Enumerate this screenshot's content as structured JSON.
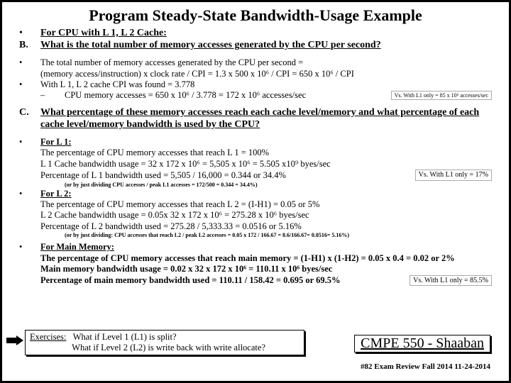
{
  "title": "Program Steady-State Bandwidth-Usage Example",
  "qB": {
    "bullet": "•",
    "label": "B.",
    "intro": "For CPU with  L 1, L 2 Cache:",
    "question": "What is the total number of memory accesses generated by the CPU per second?"
  },
  "calcB": {
    "b1": "•",
    "line1": "The total number of memory accesses generated by the CPU per second   =",
    "line2": "(memory access/instruction)  x clock rate / CPI  =  1.3 x 500 x 10⁶ / CPI =  650 x 10⁶ / CPI",
    "b2": "•",
    "line3": "With  L 1, L 2 cache CPI was found = 3.778",
    "dash": "–",
    "line4": "CPU memory accesses = 650 x 10⁶ / 3.778   =   172  x   10⁶   accesses/sec",
    "cmp": "Vs.   With L1 only = 85  x   10⁶  accesses/sec"
  },
  "qC": {
    "label": "C.",
    "question_a": "What percentage of these memory accesses reach each cache level/memory and what percentage of each",
    "question_b": "cache level/memory bandwidth is used by the CPU?"
  },
  "L1": {
    "bullet": "•",
    "head": "For L 1:",
    "l1": "The percentage of CPU memory accesses that reach L 1 = 100%",
    "l2": "L 1 Cache bandwidth usage =  32 x 172 x  10⁶ =  5,505 x 10⁶ = 5.505 x10⁹ byes/sec",
    "l3": "Percentage of L 1 bandwidth used = 5,505 / 16,000 = 0.344 or  34.4%",
    "tiny": "(or   by just dividing   CPU accesses / peak L1 accesses  =  172/500  =  0.344 = 34.4%)",
    "cmp": "Vs.  With L1 only = 17%"
  },
  "L2": {
    "bullet": "•",
    "head": "For L 2:",
    "l1": "The percentage of CPU memory accesses that reach L 2 = (I-H1) = 0.05 or  5%",
    "l2": "L 2 Cache bandwidth usage =  0.05x 32 x 172 x  10⁶ =  275.28 x 10⁶  byes/sec",
    "l3": "Percentage of L 2 bandwidth used = 275.28 / 5,333.33 = 0.0516 or  5.16%",
    "tiny": "(or   by just dividing:   CPU accesses that reach L2 / peak L2 accesses  =  0.05 x 172 / 166.67 = 8.6/166.67=  0.0516= 5.16%)"
  },
  "MM": {
    "bullet": "•",
    "head": "For Main Memory:",
    "l1": "The percentage of CPU memory accesses that reach main memory =  (1-H1) x (1-H2) = 0.05 x 0.4 =  0.02 or  2%",
    "l2": "Main memory bandwidth usage =  0.02 x 32 x 172 x  10⁶ =   110.11 x 10⁶ byes/sec",
    "l3": "Percentage of main memory bandwidth used = 110.11 / 158.42 = 0.695 or  69.5%",
    "cmp": "Vs.  With L1 only = 85.5%"
  },
  "exercises": {
    "label": "Exercises:",
    "q1": "What if Level 1 (L1) is split?",
    "q2": "What if Level 2 (L2) is write back with write allocate?"
  },
  "course": "CMPE 550 - Shaaban",
  "footer": "#82   Exam  Review   Fall 2014   11-24-2014"
}
